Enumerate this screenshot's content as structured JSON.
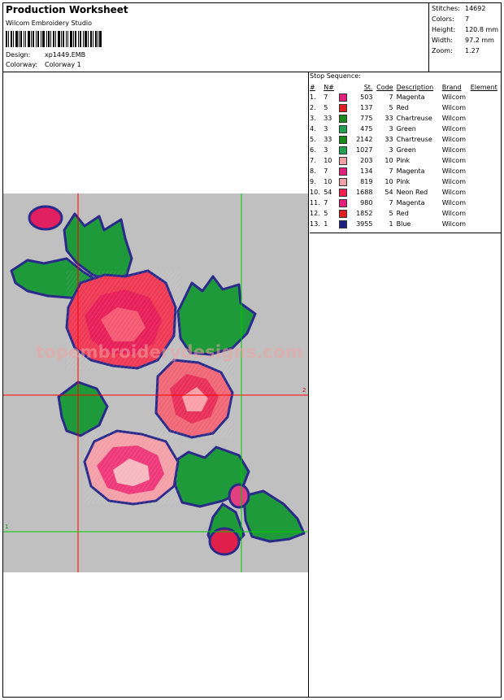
{
  "header": {
    "title": "Production Worksheet",
    "software": "Wilcom Embroidery Studio",
    "design_label": "Design:",
    "design_value": "xp1449.EMB",
    "colorway_label": "Colorway:",
    "colorway_value": "Colorway 1"
  },
  "stats": [
    {
      "label": "Stitches:",
      "value": "14692"
    },
    {
      "label": "Colors:",
      "value": "7"
    },
    {
      "label": "Height:",
      "value": "120.8 mm"
    },
    {
      "label": "Width:",
      "value": "97.2 mm"
    },
    {
      "label": "Zoom:",
      "value": "1.27"
    }
  ],
  "stops": {
    "title": "Stop Sequence:",
    "headers": [
      "#",
      "N#",
      "",
      "St.",
      "Code",
      "Description",
      "Brand",
      "Element"
    ],
    "rows": [
      {
        "num": "1.",
        "n": "7",
        "color": "#e0207a",
        "st": "503",
        "code": "7",
        "desc": "Magenta",
        "brand": "Wilcom"
      },
      {
        "num": "2.",
        "n": "5",
        "color": "#e02020",
        "st": "137",
        "code": "5",
        "desc": "Red",
        "brand": "Wilcom"
      },
      {
        "num": "3.",
        "n": "33",
        "color": "#1a8a1a",
        "st": "775",
        "code": "33",
        "desc": "Chartreuse",
        "brand": "Wilcom"
      },
      {
        "num": "4.",
        "n": "3",
        "color": "#20a050",
        "st": "475",
        "code": "3",
        "desc": "Green",
        "brand": "Wilcom"
      },
      {
        "num": "5.",
        "n": "33",
        "color": "#1a8a1a",
        "st": "2142",
        "code": "33",
        "desc": "Chartreuse",
        "brand": "Wilcom"
      },
      {
        "num": "6.",
        "n": "3",
        "color": "#20a050",
        "st": "1027",
        "code": "3",
        "desc": "Green",
        "brand": "Wilcom"
      },
      {
        "num": "7.",
        "n": "10",
        "color": "#f0a0a8",
        "st": "203",
        "code": "10",
        "desc": "Pink",
        "brand": "Wilcom"
      },
      {
        "num": "8.",
        "n": "7",
        "color": "#e0207a",
        "st": "134",
        "code": "7",
        "desc": "Magenta",
        "brand": "Wilcom"
      },
      {
        "num": "9.",
        "n": "10",
        "color": "#f0a0a8",
        "st": "819",
        "code": "10",
        "desc": "Pink",
        "brand": "Wilcom"
      },
      {
        "num": "10.",
        "n": "54",
        "color": "#f02050",
        "st": "1688",
        "code": "54",
        "desc": "Neon Red",
        "brand": "Wilcom"
      },
      {
        "num": "11.",
        "n": "7",
        "color": "#e0207a",
        "st": "980",
        "code": "7",
        "desc": "Magenta",
        "brand": "Wilcom"
      },
      {
        "num": "12.",
        "n": "5",
        "color": "#e02020",
        "st": "1852",
        "code": "5",
        "desc": "Red",
        "brand": "Wilcom"
      },
      {
        "num": "13.",
        "n": "1",
        "color": "#202080",
        "st": "3955",
        "code": "1",
        "desc": "Blue",
        "brand": "Wilcom"
      }
    ]
  },
  "canvas": {
    "watermark": "topembroiderydesigns.com",
    "axis_label_red": "2",
    "axis_label_green": "1"
  }
}
